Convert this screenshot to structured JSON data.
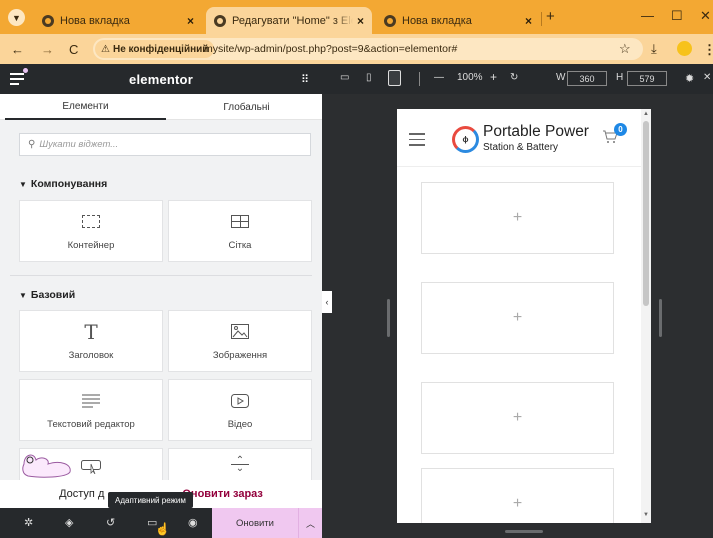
{
  "browser": {
    "tabs": [
      {
        "label": "Нова вкладка",
        "active": false
      },
      {
        "label": "Редагувати \"Home\" з Elementor",
        "active": true
      },
      {
        "label": "Нова вкладка",
        "active": false
      }
    ],
    "new_tab": "+",
    "security_label": "Не конфіденційний",
    "url": "mysite/wp-admin/post.php?post=9&action=elementor#"
  },
  "panel": {
    "logo": "elementor",
    "tabs": [
      "Елементи",
      "Глобальні"
    ],
    "search_placeholder": "Шукати віджет...",
    "sections": [
      {
        "title": "Компонування",
        "widgets": [
          "Контейнер",
          "Сітка"
        ]
      },
      {
        "title": "Базовий",
        "widgets": [
          "Заголовок",
          "Зображення",
          "Текстовий редактор",
          "Відео"
        ]
      }
    ],
    "notice_text": "Доступ д",
    "notice_link": "Оновити зараз",
    "tooltip": "Адаптивний режим",
    "update_button": "Оновити"
  },
  "canvas_toolbar": {
    "zoom": "100%",
    "zoom_minus": "—",
    "zoom_plus": "+",
    "width_label": "W",
    "width_value": "360",
    "height_label": "H",
    "height_value": "579"
  },
  "preview": {
    "brand_title": "Portable Power",
    "brand_subtitle": "Station & Battery",
    "cart_count": "0",
    "placeholder": "+"
  },
  "colors": {
    "tab_strip": "#f3a833",
    "address_bar": "#fbd59a",
    "panel_dark": "#26292c",
    "update_button": "#f0c8f0",
    "cart_badge": "#1e88e5"
  }
}
